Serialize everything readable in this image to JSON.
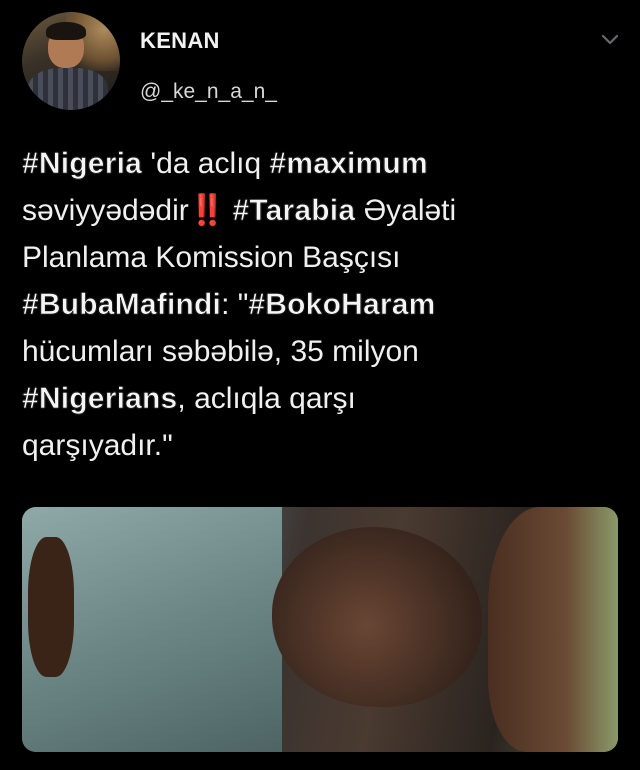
{
  "tweet": {
    "display_name": "KENAN",
    "handle": "@_ke_n_a_n_",
    "menu_icon": "chevron-down-icon",
    "text_lines": [
      [
        {
          "text": "#Nigeria",
          "tag": true
        },
        {
          "text": " 'da aclıq ",
          "tag": false
        },
        {
          "text": "#maximum",
          "tag": true
        }
      ],
      [
        {
          "text": "səviyyədədir",
          "tag": false
        },
        {
          "text": "‼️",
          "tag": false,
          "bang": true
        },
        {
          "text": " ",
          "tag": false
        },
        {
          "text": "#Tarabia",
          "tag": true
        },
        {
          "text": " Əyaləti",
          "tag": false
        }
      ],
      [
        {
          "text": "Planlama Komission Başçısı",
          "tag": false
        }
      ],
      [
        {
          "text": "#BubaMafindi",
          "tag": true
        },
        {
          "text": ": \"",
          "tag": false
        },
        {
          "text": "#BokoHaram",
          "tag": true
        }
      ],
      [
        {
          "text": "hücumları səbəbilə, 35 milyon",
          "tag": false
        }
      ],
      [
        {
          "text": "#Nigerians",
          "tag": true
        },
        {
          "text": ", aclıqla qarşı",
          "tag": false
        }
      ],
      [
        {
          "text": "qarşıyadır.\"",
          "tag": false
        }
      ]
    ],
    "media_description_icon": "photo-image"
  },
  "colors": {
    "background": "#000000",
    "text": "#f0f0f0",
    "emoji_red": "#e0202a"
  }
}
